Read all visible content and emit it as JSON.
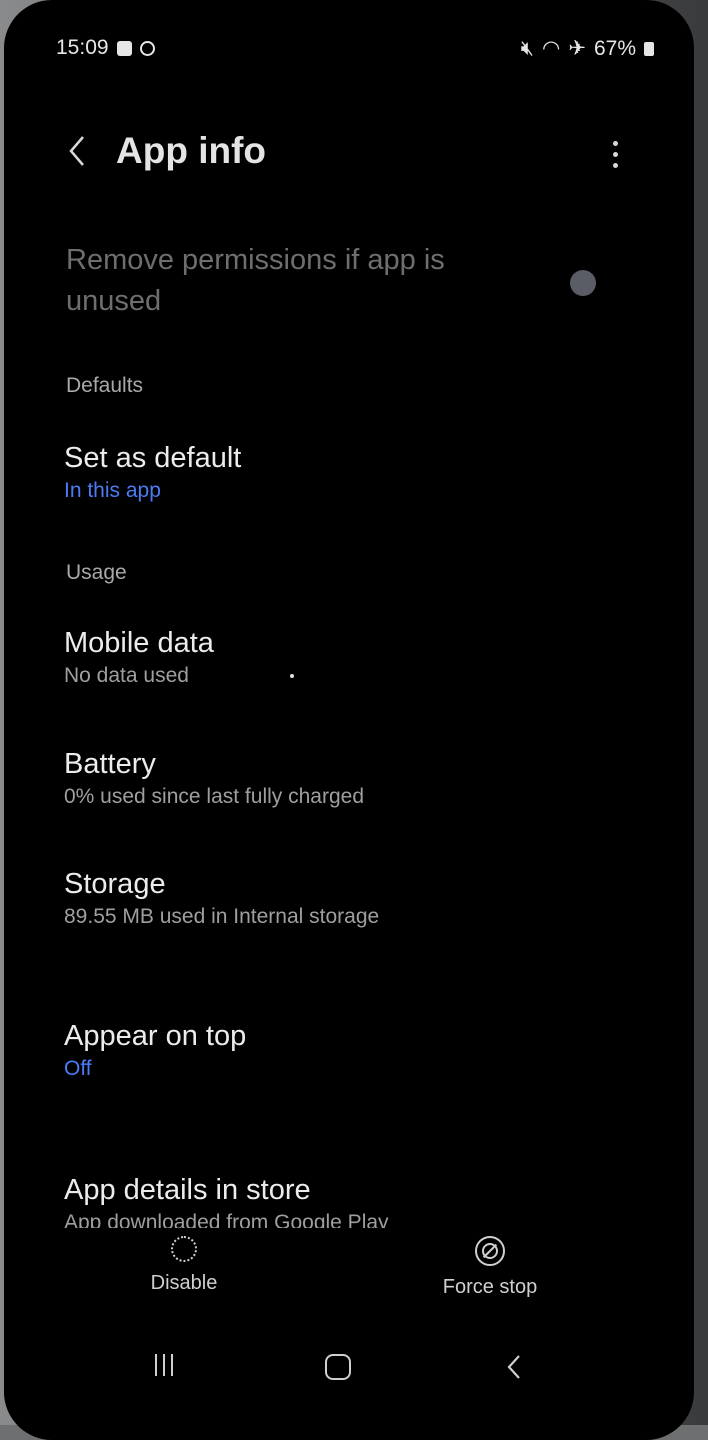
{
  "status_bar": {
    "time": "15:09",
    "battery": "67%"
  },
  "header": {
    "title": "App info",
    "back_icon": "chevron-left-icon",
    "more_icon": "more-vert-icon"
  },
  "remove_permissions": {
    "label": "Remove permissions if app is unused",
    "toggle_on": false
  },
  "sections": {
    "defaults": "Defaults",
    "usage": "Usage"
  },
  "items": {
    "set_as_default": {
      "title": "Set as default",
      "subtitle": "In this app"
    },
    "mobile_data": {
      "title": "Mobile data",
      "subtitle": "No data used"
    },
    "battery": {
      "title": "Battery",
      "subtitle": "0% used since last fully charged"
    },
    "storage": {
      "title": "Storage",
      "subtitle": "89.55 MB used in Internal storage"
    },
    "appear_on_top": {
      "title": "Appear on top",
      "subtitle": "Off"
    },
    "app_details": {
      "title": "App details in store",
      "subtitle": "App downloaded from Google Play"
    }
  },
  "bottom_actions": {
    "disable": "Disable",
    "force_stop": "Force stop"
  },
  "colors": {
    "accent": "#4b7bf5",
    "background": "#000000"
  }
}
